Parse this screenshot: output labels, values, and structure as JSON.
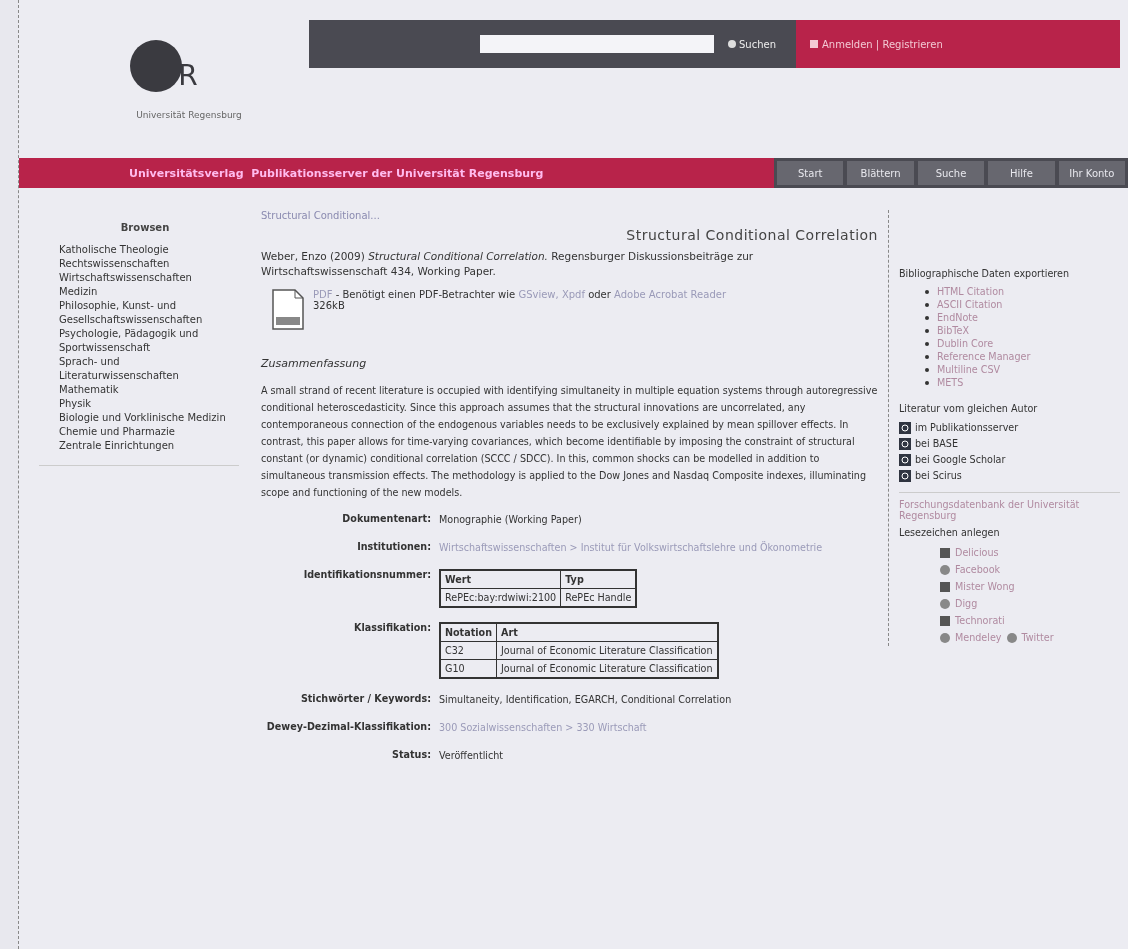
{
  "header": {
    "logo_letter": "R",
    "logo_caption": "Universität Regensburg",
    "search_button": "Suchen",
    "account_links": "Anmelden | Registrieren"
  },
  "banner": {
    "title": "Universitätsverlag  Publikationsserver der Universität Regensburg",
    "nav": [
      "Start",
      "Blättern",
      "Suche",
      "Hilfe",
      "Ihr Konto"
    ]
  },
  "sidebar": {
    "title": "Browsen",
    "items": [
      "Katholische Theologie",
      "Rechtswissenschaften",
      "Wirtschaftswissenschaften",
      "Medizin",
      "Philosophie, Kunst- und Gesellschaftswissenschaften",
      "Psychologie, Pädagogik und Sportwissenschaft",
      "Sprach- und Literaturwissenschaften",
      "Mathematik",
      "Physik",
      "Biologie und Vorklinische Medizin",
      "Chemie und Pharmazie",
      "Zentrale Einrichtungen"
    ]
  },
  "breadcrumb": "Structural Conditional...",
  "article": {
    "title": "Structural Conditional Correlation",
    "citation": "Weber, Enzo (2009) *Structural Conditional Correlation.* Regensburger Diskussionsbeiträge zur Wirtschaftswissenschaft 434, Working Paper.",
    "file": {
      "format": "PDF",
      "note": " - Benötigt einen PDF-Betrachter wie ",
      "viewer_1": "GSview, Xpdf",
      "or": " oder ",
      "viewer_2": "Adobe Acrobat Reader",
      "size": "326kB"
    },
    "abstract_heading": "Zusammenfassung",
    "abstract": "A small strand of recent literature is occupied with identifying simultaneity in multiple equation systems through autoregressive conditional heteroscedasticity. Since this approach assumes that the structural innovations are uncorrelated, any contemporaneous connection of the endogenous variables needs to be exclusively explained by mean spillover effects. In contrast, this paper allows for time-varying covariances, which become identifiable by imposing the constraint of structural constant (or dynamic) conditional correlation (SCCC / SDCC). In this, common shocks can be modelled in addition to simultaneous transmission effects. The methodology is applied to the Dow Jones and Nasdaq Composite indexes, illuminating scope and functioning of the new models.",
    "fields": [
      {
        "kind": "text",
        "label": "Dokumentenart:",
        "value": "Monographie (Working Paper)"
      },
      {
        "kind": "link",
        "label": "Institutionen:",
        "value": "Wirtschaftswissenschaften > Institut für Volkswirtschaftslehre und Ökonometrie"
      },
      {
        "kind": "table",
        "label": "Identifikationsnummer:",
        "columns": [
          "Wert",
          "Typ"
        ],
        "rows": [
          [
            "RePEc:bay:rdwiwi:2100",
            "RePEc Handle"
          ]
        ]
      },
      {
        "kind": "table",
        "label": "Klassifikation:",
        "columns": [
          "Notation",
          "Art"
        ],
        "rows": [
          [
            "C32",
            "Journal of Economic Literature Classification"
          ],
          [
            "G10",
            "Journal of Economic Literature Classification"
          ]
        ]
      },
      {
        "kind": "text",
        "label": "Stichwörter / Keywords:",
        "value": "Simultaneity, Identification, EGARCH, Conditional Correlation"
      },
      {
        "kind": "link",
        "label": "Dewey-Dezimal-Klassifikation:",
        "value": "300 Sozialwissenschaften > 330 Wirtschaft"
      },
      {
        "kind": "text",
        "label": "Status:",
        "value": "Veröffentlicht"
      }
    ]
  },
  "right": {
    "export_title": "Bibliographische Daten exportieren",
    "export_items": [
      "HTML Citation",
      "ASCII Citation",
      "EndNote",
      "BibTeX",
      "Dublin Core",
      "Reference Manager",
      "Multiline CSV",
      "METS"
    ],
    "author_title": "Literatur vom gleichen Autor",
    "author_items": [
      "im Publikationsserver",
      "bei BASE",
      "bei Google Scholar",
      "bei Scirus"
    ],
    "more_link": "Forschungsdatenbank der Universität Regensburg",
    "bookmark_title": "Lesezeichen anlegen",
    "bookmarks": [
      "Delicious",
      "Facebook",
      "Mister Wong",
      "Digg",
      "Technorati",
      "Mendeley"
    ],
    "bookmark_extra": "Twitter"
  }
}
